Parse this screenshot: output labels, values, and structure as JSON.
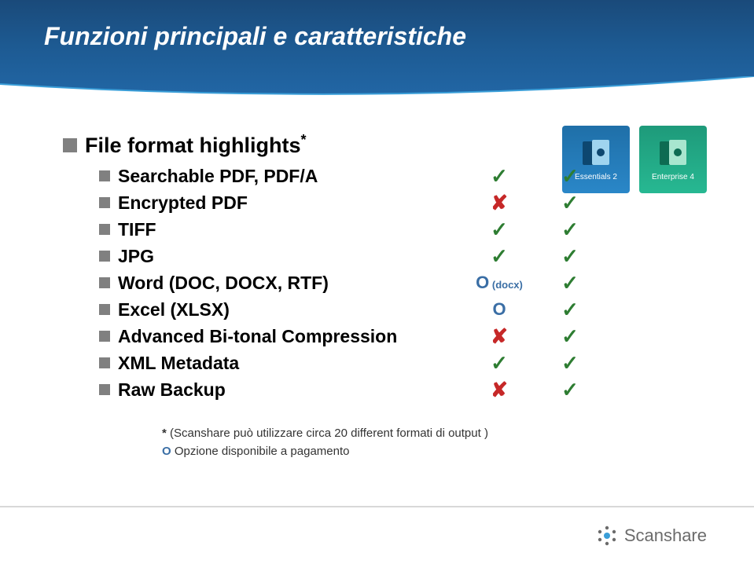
{
  "header": {
    "title": "Funzioni principali e caratteristiche"
  },
  "heading": {
    "text": "File format highlights",
    "sup": "*"
  },
  "products": {
    "essentials": {
      "label": "Essentials 2"
    },
    "enterprise": {
      "label": "Enterprise 4"
    }
  },
  "rows": [
    {
      "label": "Searchable PDF, PDF/A",
      "c1_type": "check",
      "c1": "✓",
      "c2_type": "check",
      "c2": "✓"
    },
    {
      "label": "Encrypted PDF",
      "c1_type": "cross",
      "c1": "✘",
      "c2_type": "check",
      "c2": "✓"
    },
    {
      "label": "TIFF",
      "c1_type": "check",
      "c1": "✓",
      "c2_type": "check",
      "c2": "✓"
    },
    {
      "label": "JPG",
      "c1_type": "check",
      "c1": "✓",
      "c2_type": "check",
      "c2": "✓"
    },
    {
      "label": "Word (DOC, DOCX, RTF)",
      "c1_type": "opt",
      "c1": "O",
      "c1_extra": "(docx)",
      "c2_type": "check",
      "c2": "✓"
    },
    {
      "label": "Excel (XLSX)",
      "c1_type": "opt",
      "c1": "O",
      "c2_type": "check",
      "c2": "✓"
    },
    {
      "label": "Advanced Bi-tonal Compression",
      "c1_type": "cross",
      "c1": "✘",
      "c2_type": "check",
      "c2": "✓"
    },
    {
      "label": "XML Metadata",
      "c1_type": "check",
      "c1": "✓",
      "c2_type": "check",
      "c2": "✓"
    },
    {
      "label": "Raw Backup",
      "c1_type": "cross",
      "c1": "✘",
      "c2_type": "check",
      "c2": "✓"
    }
  ],
  "footnotes": {
    "line1_star": "*",
    "line1": " (Scanshare può utilizzare circa 20 different formati di output )",
    "line2_o": "O",
    "line2": " Opzione disponibile a pagamento"
  },
  "footer": {
    "brand": "Scanshare"
  }
}
